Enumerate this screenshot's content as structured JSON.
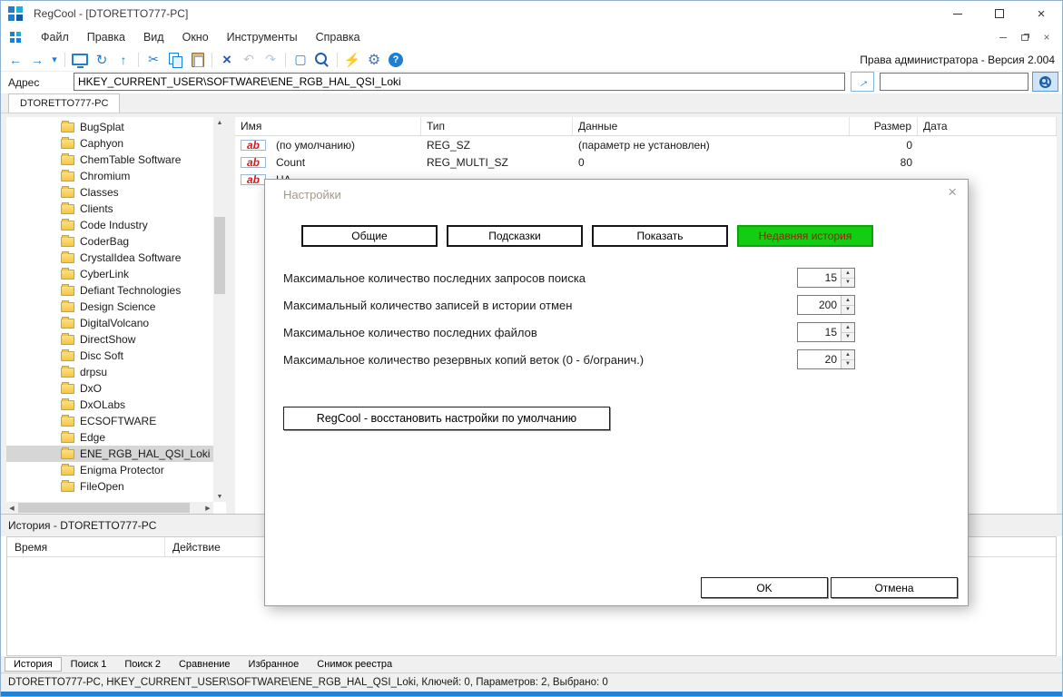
{
  "window": {
    "title": "RegCool - [DTORETTO777-PC]"
  },
  "menu": {
    "items": [
      {
        "name": "menu-file",
        "label": "Файл"
      },
      {
        "name": "menu-edit",
        "label": "Правка"
      },
      {
        "name": "menu-view",
        "label": "Вид"
      },
      {
        "name": "menu-window",
        "label": "Окно"
      },
      {
        "name": "menu-tools",
        "label": "Инструменты"
      },
      {
        "name": "menu-help",
        "label": "Справка"
      }
    ]
  },
  "toolbar": {
    "admin_text": "Права администратора - Версия 2.004",
    "buttons": [
      {
        "name": "back-icon",
        "glyph": "←"
      },
      {
        "name": "forward-icon",
        "glyph": "→"
      },
      {
        "name": "history-dropdown-icon",
        "glyph": "▾"
      },
      {
        "name": "separator",
        "glyph": "",
        "interactable": false
      },
      {
        "name": "connect-monitor-icon",
        "glyph": ""
      },
      {
        "name": "monitor-refresh-icon",
        "glyph": "↻"
      },
      {
        "name": "up-icon",
        "glyph": "↑"
      },
      {
        "name": "separator",
        "glyph": "",
        "interactable": false
      },
      {
        "name": "cut-icon",
        "glyph": "✂"
      },
      {
        "name": "copy-icon",
        "glyph": ""
      },
      {
        "name": "paste-icon",
        "glyph": ""
      },
      {
        "name": "separator",
        "glyph": "",
        "interactable": false
      },
      {
        "name": "delete-icon",
        "glyph": "×"
      },
      {
        "name": "undo-icon",
        "glyph": "↶",
        "disabled": true
      },
      {
        "name": "redo-icon",
        "glyph": "↷",
        "disabled": true
      },
      {
        "name": "separator",
        "glyph": "",
        "interactable": false
      },
      {
        "name": "edit-box-icon",
        "glyph": "▢"
      },
      {
        "name": "search-icon",
        "glyph": ""
      },
      {
        "name": "separator",
        "glyph": "",
        "interactable": false
      },
      {
        "name": "refresh-all-icon",
        "glyph": "⚡"
      },
      {
        "name": "settings-gear-icon",
        "glyph": "⚙"
      },
      {
        "name": "help-icon",
        "glyph": ""
      }
    ]
  },
  "address": {
    "label": "Адрес",
    "value": "HKEY_CURRENT_USER\\SOFTWARE\\ENE_RGB_HAL_QSI_Loki",
    "search_value": ""
  },
  "workspace": {
    "tab": "DTORETTO777-PC"
  },
  "tree": {
    "items": [
      {
        "label": "BugSplat"
      },
      {
        "label": "Caphyon"
      },
      {
        "label": "ChemTable Software"
      },
      {
        "label": "Chromium"
      },
      {
        "label": "Classes"
      },
      {
        "label": "Clients"
      },
      {
        "label": "Code Industry"
      },
      {
        "label": "CoderBag"
      },
      {
        "label": "CrystalIdea Software"
      },
      {
        "label": "CyberLink"
      },
      {
        "label": "Defiant Technologies"
      },
      {
        "label": "Design Science"
      },
      {
        "label": "DigitalVolcano"
      },
      {
        "label": "DirectShow"
      },
      {
        "label": "Disc Soft"
      },
      {
        "label": "drpsu"
      },
      {
        "label": "DxO"
      },
      {
        "label": "DxOLabs"
      },
      {
        "label": "ECSOFTWARE"
      },
      {
        "label": "Edge"
      },
      {
        "label": "ENE_RGB_HAL_QSI_Loki",
        "selected": true
      },
      {
        "label": "Enigma Protector"
      },
      {
        "label": "FileOpen"
      }
    ]
  },
  "icons": {
    "string_value_glyph": "ab"
  },
  "values_table": {
    "columns": [
      "Имя",
      "Тип",
      "Данные",
      "Размер",
      "Дата"
    ],
    "rows": [
      {
        "name": "(по умолчанию)",
        "type": "REG_SZ",
        "data": "(параметр не установлен)",
        "size": "0",
        "date": ""
      },
      {
        "name": "Count",
        "type": "REG_MULTI_SZ",
        "data": "0",
        "size": "80",
        "date": ""
      },
      {
        "name": "HA",
        "type": "",
        "data": "",
        "size": "",
        "date": ""
      }
    ]
  },
  "dialog": {
    "title": "Настройки",
    "tabs": [
      {
        "name": "tab-general",
        "label": "Общие"
      },
      {
        "name": "tab-hints",
        "label": "Подсказки"
      },
      {
        "name": "tab-show",
        "label": "Показать"
      },
      {
        "name": "tab-recent-history",
        "label": "Недавняя история",
        "selected": true
      }
    ],
    "settings": [
      {
        "label": "Максимальное количество последних запросов поиска",
        "value": "15"
      },
      {
        "label": "Максимальный количество записей в истории отмен",
        "value": "200"
      },
      {
        "label": "Максимальное количество последних файлов",
        "value": "15"
      },
      {
        "label": "Максимальное количество резервных копий веток (0 - б/огранич.)",
        "value": "20"
      }
    ],
    "restore_label": "RegCool - восстановить настройки по умолчанию",
    "ok_label": "OK",
    "cancel_label": "Отмена"
  },
  "history": {
    "title": "История - DTORETTO777-PC",
    "columns": [
      "Время",
      "Действие"
    ]
  },
  "bottom_tabs": [
    {
      "name": "tab-history",
      "label": "История",
      "selected": true
    },
    {
      "name": "tab-search-1",
      "label": "Поиск 1"
    },
    {
      "name": "tab-search-2",
      "label": "Поиск 2"
    },
    {
      "name": "tab-compare",
      "label": "Сравнение"
    },
    {
      "name": "tab-favorites",
      "label": "Избранное"
    },
    {
      "name": "tab-registry-snapshot",
      "label": "Снимок реестра"
    }
  ],
  "status": {
    "text": "DTORETTO777-PC, HKEY_CURRENT_USER\\SOFTWARE\\ENE_RGB_HAL_QSI_Loki, Ключей: 0, Параметров: 2, Выбрано: 0"
  }
}
